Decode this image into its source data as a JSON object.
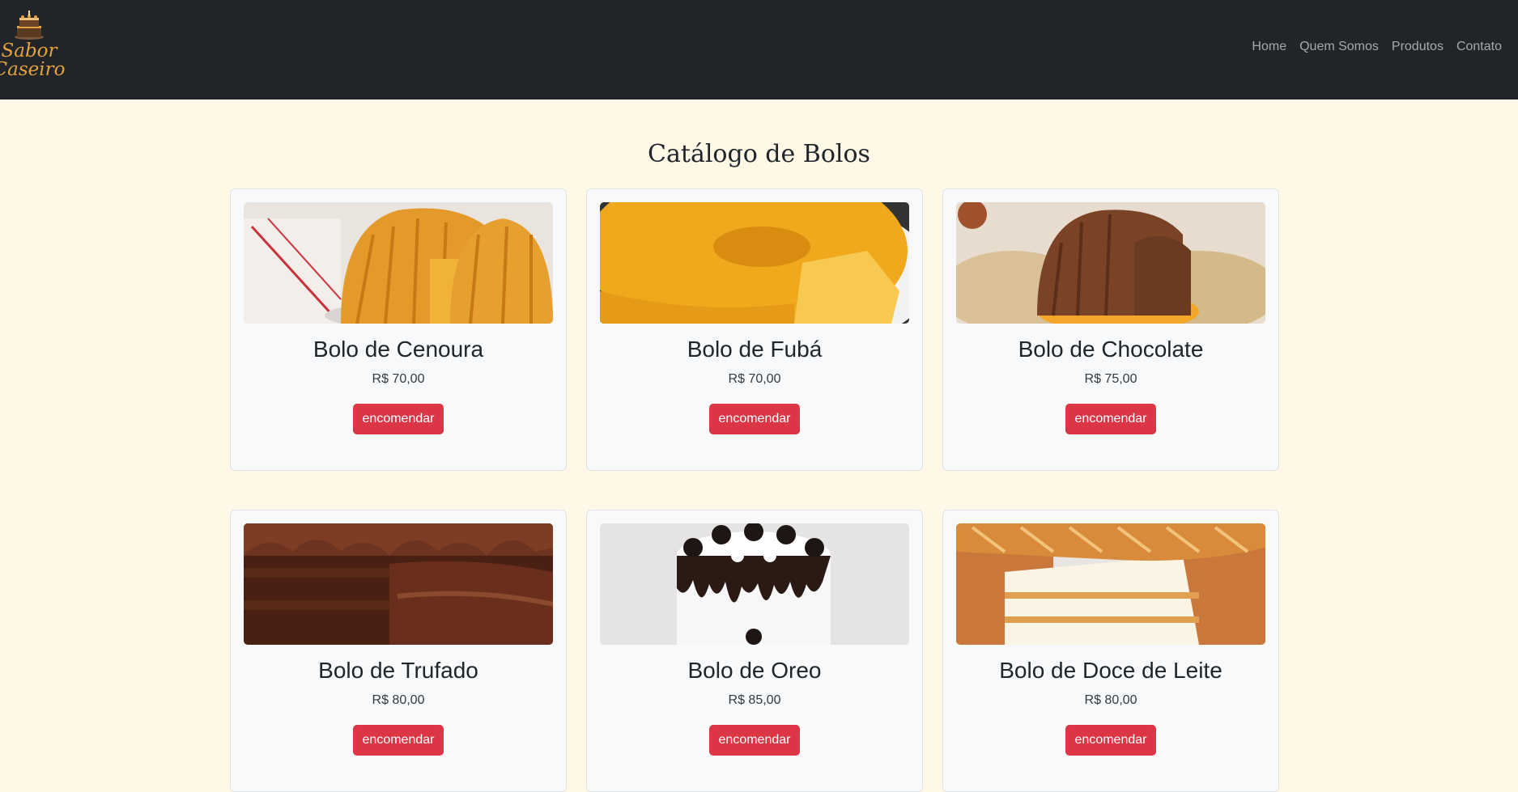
{
  "brand": {
    "line1": "Sabor",
    "line2": "Caseiro"
  },
  "nav": {
    "items": [
      {
        "label": "Home"
      },
      {
        "label": "Quem Somos"
      },
      {
        "label": "Produtos"
      },
      {
        "label": "Contato"
      }
    ]
  },
  "main": {
    "title": "Catálogo de Bolos",
    "cards": [
      {
        "title": "Bolo de Cenoura",
        "price": "R$ 70,00",
        "button": "encomendar",
        "image": "carrot-bundt-cake"
      },
      {
        "title": "Bolo de Fubá",
        "price": "R$ 70,00",
        "button": "encomendar",
        "image": "cornmeal-ring-cake"
      },
      {
        "title": "Bolo de Chocolate",
        "price": "R$ 75,00",
        "button": "encomendar",
        "image": "chocolate-bundt-cake"
      },
      {
        "title": "Bolo de Trufado",
        "price": "R$ 80,00",
        "button": "encomendar",
        "image": "truffle-cake"
      },
      {
        "title": "Bolo de Oreo",
        "price": "R$ 85,00",
        "button": "encomendar",
        "image": "oreo-cake"
      },
      {
        "title": "Bolo de Doce de Leite",
        "price": "R$ 80,00",
        "button": "encomendar",
        "image": "dulce-de-leche-cake"
      }
    ]
  },
  "colors": {
    "navbar": "#212529",
    "background": "#fff8e6",
    "button": "#dc3545",
    "brand": "#e3a23a"
  }
}
